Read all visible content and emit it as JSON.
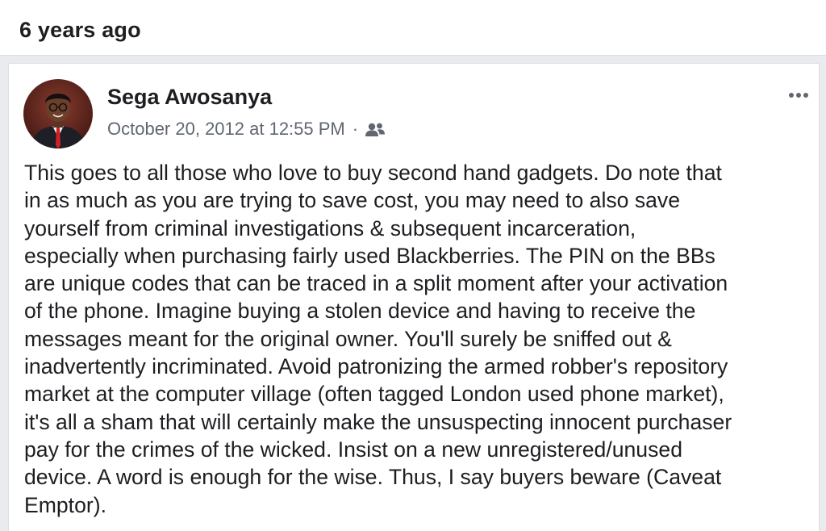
{
  "memory": {
    "time_ago": "6 years ago"
  },
  "post": {
    "author": "Sega Awosanya",
    "timestamp": "October 20, 2012 at 12:55 PM",
    "separator": "·",
    "audience_icon": "friends-icon",
    "menu_icon": "more-options-icon",
    "lines": [
      "This goes to all those who love to buy second hand gadgets. Do note that",
      "in as much as you are trying to save cost, you may need to also save",
      "yourself from criminal investigations & subsequent incarceration,",
      "especially when purchasing fairly used Blackberries. The PIN on the BBs",
      "are unique codes that can be traced in a split moment after your activation",
      "of the phone. Imagine buying a stolen device and having to receive the",
      "messages meant for the original owner. You'll surely be sniffed out &",
      "inadvertently incriminated. Avoid patronizing the armed robber's repository",
      "market at the computer village (often tagged London used phone market),",
      "it's all a sham that will certainly make the unsuspecting innocent purchaser",
      "pay for the crimes of the wicked. Insist on a new unregistered/unused",
      "device. A word is enough for the wise. Thus, I say buyers beware (Caveat",
      "Emptor)."
    ]
  },
  "colors": {
    "page_background": "#e9ebee",
    "card_background": "#ffffff",
    "primary_text": "#1c1e21",
    "secondary_text": "#606770"
  }
}
